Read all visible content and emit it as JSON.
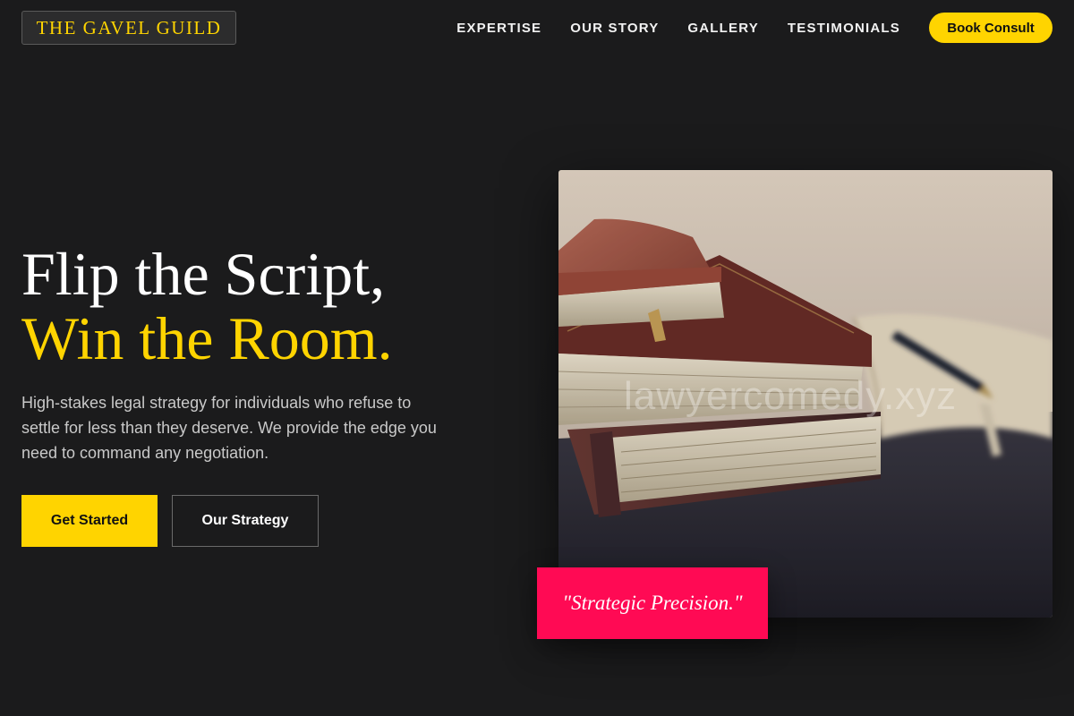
{
  "header": {
    "logo_text": "THE GAVEL GUILD",
    "nav": [
      {
        "label": "EXPERTISE"
      },
      {
        "label": "OUR STORY"
      },
      {
        "label": "GALLERY"
      },
      {
        "label": "TESTIMONIALS"
      }
    ],
    "cta_label": "Book Consult"
  },
  "hero": {
    "headline_line1": "Flip the Script,",
    "headline_line2": "Win the Room.",
    "subtext": "High-stakes legal strategy for individuals who refuse to settle for less than they deserve. We provide the edge you need to command any negotiation.",
    "primary_button": "Get Started",
    "secondary_button": "Our Strategy",
    "image": {
      "subject": "books-and-pen-icon",
      "watermark": "lawyercomedy.xyz"
    },
    "quote": "\"Strategic Precision.\""
  },
  "colors": {
    "background": "#1b1b1c",
    "accent": "#ffd400",
    "quote_bg": "#ff0a54",
    "text_muted": "#c9c9c9"
  }
}
